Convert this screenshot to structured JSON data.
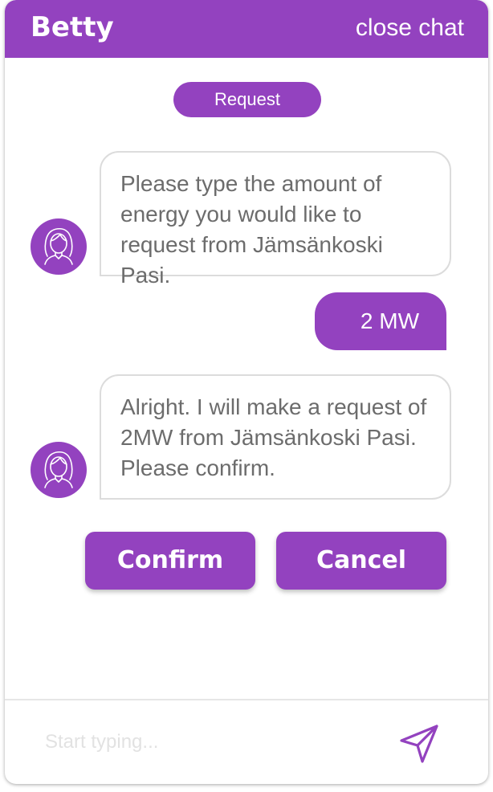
{
  "colors": {
    "accent": "#9342bf",
    "bubble_border": "#dcdcdc",
    "bot_text": "#6c6c6c",
    "placeholder": "#e2e2e2"
  },
  "header": {
    "title": "Betty",
    "close_label": "close chat"
  },
  "section_label": "Request",
  "messages": [
    {
      "sender": "bot",
      "avatar_icon": "woman-avatar-icon",
      "lines": [
        "Please type the amount of",
        "energy you would like to",
        "request from Jämsänkoski Pasi."
      ]
    },
    {
      "sender": "user",
      "text": "2 MW"
    },
    {
      "sender": "bot",
      "avatar_icon": "woman-avatar-icon",
      "lines": [
        "Alright. I will make a request of",
        "2MW from Jämsänkoski Pasi.",
        "Please confirm."
      ]
    }
  ],
  "actions": {
    "confirm_label": "Confirm",
    "cancel_label": "Cancel"
  },
  "composer": {
    "placeholder": "Start typing...",
    "send_icon": "send-paper-plane-icon"
  }
}
